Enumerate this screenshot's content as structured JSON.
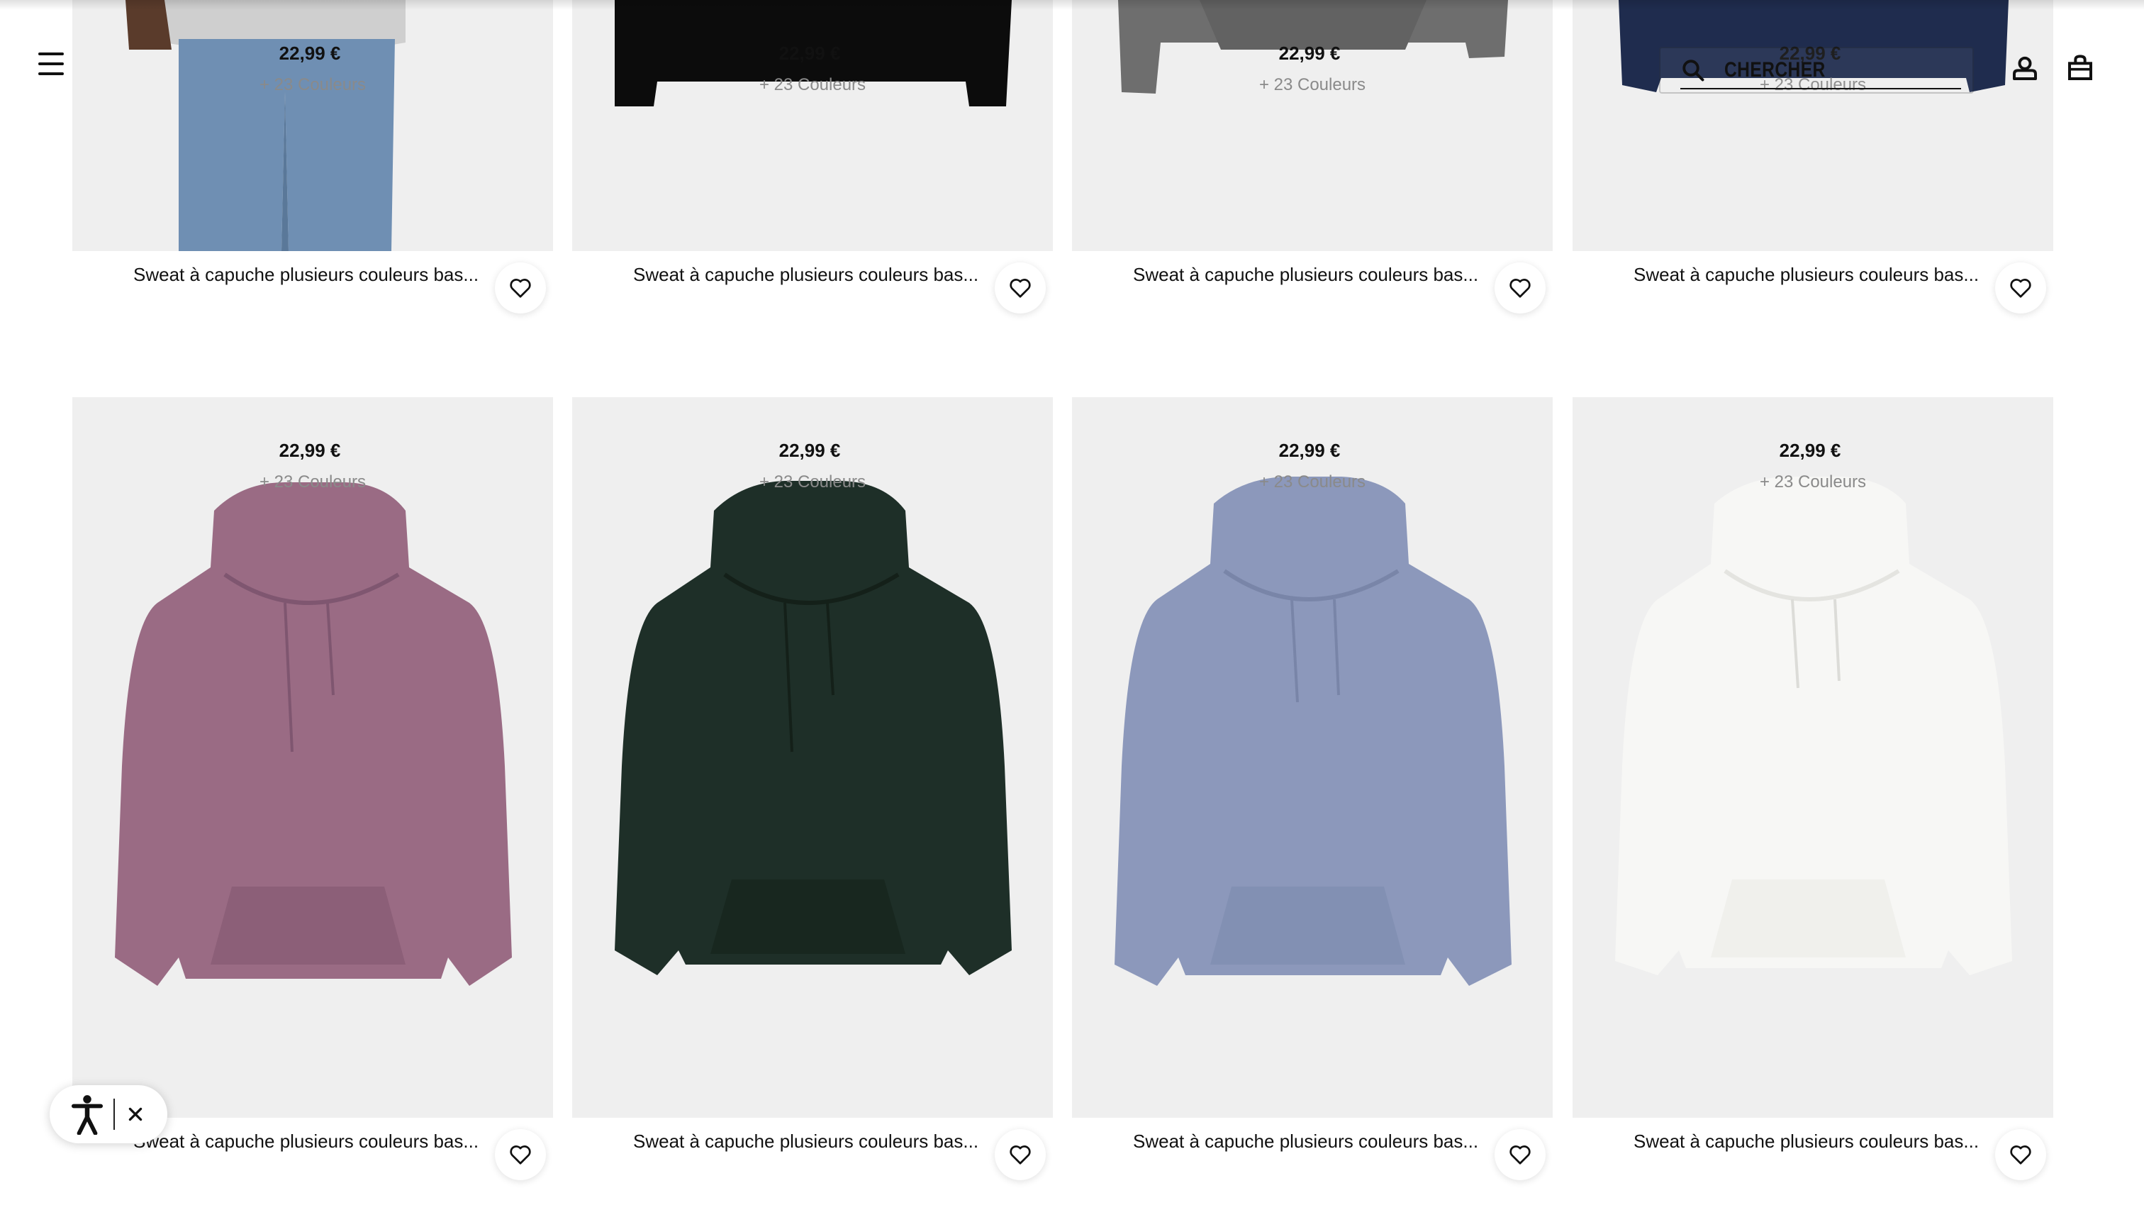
{
  "header": {
    "search_placeholder": "CHERCHER",
    "icons": {
      "menu": "hamburger-menu-icon",
      "search": "search-icon",
      "user": "user-icon",
      "bag": "shopping-bag-icon"
    }
  },
  "products": [
    {
      "title": "Sweat à capuche plusieurs couleurs bas...",
      "price": "22,99 €",
      "colors": "+ 23 Couleurs",
      "swatch": "#6f8fb3"
    },
    {
      "title": "Sweat à capuche plusieurs couleurs bas...",
      "price": "22,99 €",
      "colors": "+ 23 Couleurs",
      "swatch": "#0c0c0c"
    },
    {
      "title": "Sweat à capuche plusieurs couleurs bas...",
      "price": "22,99 €",
      "colors": "+ 23 Couleurs",
      "swatch": "#6e6e6e"
    },
    {
      "title": "Sweat à capuche plusieurs couleurs bas...",
      "price": "22,99 €",
      "colors": "+ 23 Couleurs",
      "swatch": "#1f2c4e"
    },
    {
      "title": "Sweat à capuche plusieurs couleurs bas...",
      "price": "22,99 €",
      "colors": "+ 23 Couleurs",
      "swatch": "#9a6b84"
    },
    {
      "title": "Sweat à capuche plusieurs couleurs bas...",
      "price": "22,99 €",
      "colors": "+ 23 Couleurs",
      "swatch": "#1e2f28"
    },
    {
      "title": "Sweat à capuche plusieurs couleurs bas...",
      "price": "22,99 €",
      "colors": "+ 23 Couleurs",
      "swatch": "#8c98bb"
    },
    {
      "title": "Sweat à capuche plusieurs couleurs bas...",
      "price": "22,99 €",
      "colors": "+ 23 Couleurs",
      "swatch": "#f7f7f5"
    }
  ],
  "accessibility_widget": {
    "icon": "accessibility-person-icon",
    "close_icon": "close-icon"
  }
}
